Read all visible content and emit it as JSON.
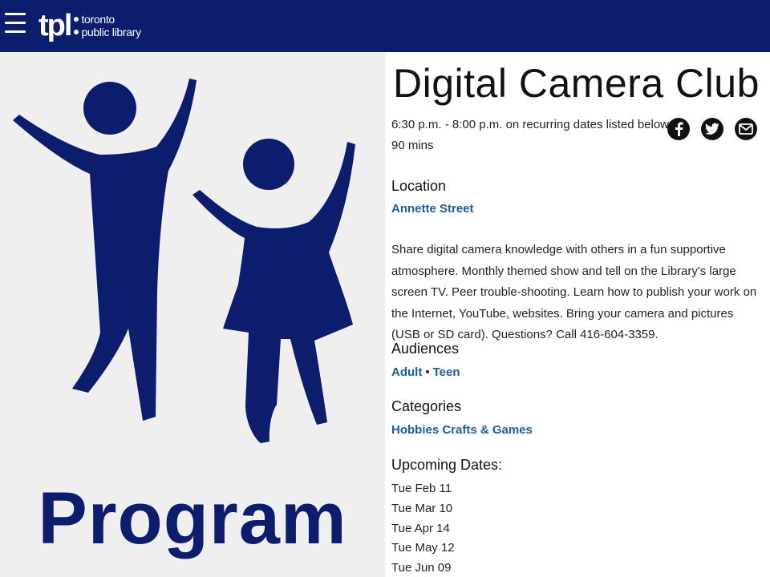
{
  "header": {
    "menu_icon": "hamburger-menu-icon",
    "logo": {
      "mark": "tpl",
      "line1": "toronto",
      "line2": "public library"
    }
  },
  "hero": {
    "word": "Program",
    "icon": "people-jumping-icon",
    "color": "#0d1d6e",
    "background": "#efefef"
  },
  "event": {
    "title": "Digital Camera Club",
    "time": "6:30 p.m. - 8:00 p.m. on recurring dates listed below",
    "duration": "90 mins",
    "share": [
      "facebook-icon",
      "twitter-icon",
      "email-icon"
    ],
    "location_heading": "Location",
    "location": "Annette Street",
    "description": "Share digital camera knowledge with others in a fun supportive atmosphere. Monthly themed show and tell on the Library's large screen TV. Peer trouble-shooting. Learn how to publish your work on the Internet, YouTube, websites. Bring your camera and pictures (USB or SD card). Questions? Call 416-604-3359.",
    "audiences_heading": "Audiences",
    "audiences": [
      "Adult",
      "Teen"
    ],
    "audience_separator": "•",
    "categories_heading": "Categories",
    "category": "Hobbies Crafts & Games",
    "dates_heading": "Upcoming Dates:",
    "dates": [
      "Tue Feb 11",
      "Tue Mar 10",
      "Tue Apr 14",
      "Tue May 12",
      "Tue Jun 09"
    ]
  },
  "colors": {
    "header_bg": "#0d1d6e",
    "link": "#1a5c9e",
    "text": "#222222"
  }
}
